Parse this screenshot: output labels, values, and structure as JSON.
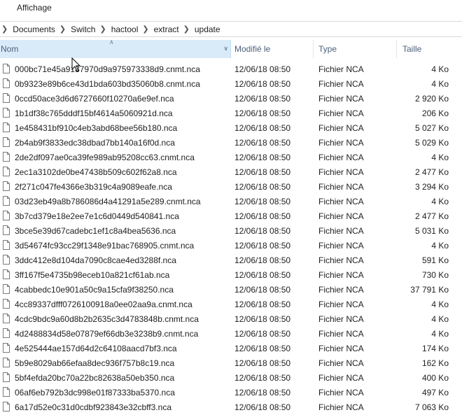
{
  "ribbon": {
    "tab": "Affichage"
  },
  "address": {
    "segments": [
      "Documents",
      "Switch",
      "hactool",
      "extract",
      "update"
    ]
  },
  "columns": {
    "name": "Nom",
    "modified": "Modifié le",
    "type": "Type",
    "size": "Taille"
  },
  "files": [
    {
      "name": "000bc71e45a9187970d9a975973338d9.cnmt.nca",
      "modified": "12/06/18 08:50",
      "type": "Fichier NCA",
      "size": "4 Ko"
    },
    {
      "name": "0b9323e89b6ce43d1bda603bd35060b8.cnmt.nca",
      "modified": "12/06/18 08:50",
      "type": "Fichier NCA",
      "size": "4 Ko"
    },
    {
      "name": "0ccd50ace3d6d6727660f10270a6e9ef.nca",
      "modified": "12/06/18 08:50",
      "type": "Fichier NCA",
      "size": "2 920 Ko"
    },
    {
      "name": "1b1df38c765dddf15bf4614a5060921d.nca",
      "modified": "12/06/18 08:50",
      "type": "Fichier NCA",
      "size": "206 Ko"
    },
    {
      "name": "1e458431bf910c4eb3abd68bee56b180.nca",
      "modified": "12/06/18 08:50",
      "type": "Fichier NCA",
      "size": "5 027 Ko"
    },
    {
      "name": "2b4ab9f3833edc38dbad7bb140a16f0d.nca",
      "modified": "12/06/18 08:50",
      "type": "Fichier NCA",
      "size": "5 029 Ko"
    },
    {
      "name": "2de2df097ae0ca39fe989ab95208cc63.cnmt.nca",
      "modified": "12/06/18 08:50",
      "type": "Fichier NCA",
      "size": "4 Ko"
    },
    {
      "name": "2ec1a3102de0be47438b509c602f62a8.nca",
      "modified": "12/06/18 08:50",
      "type": "Fichier NCA",
      "size": "2 477 Ko"
    },
    {
      "name": "2f271c047fe4366e3b319c4a9089eafe.nca",
      "modified": "12/06/18 08:50",
      "type": "Fichier NCA",
      "size": "3 294 Ko"
    },
    {
      "name": "03d23eb49a8b786086d4a41291a5e289.cnmt.nca",
      "modified": "12/06/18 08:50",
      "type": "Fichier NCA",
      "size": "4 Ko"
    },
    {
      "name": "3b7cd379e18e2ee7e1c6d0449d540841.nca",
      "modified": "12/06/18 08:50",
      "type": "Fichier NCA",
      "size": "2 477 Ko"
    },
    {
      "name": "3bce5e39d67cadebc1ef1c8a4bea5636.nca",
      "modified": "12/06/18 08:50",
      "type": "Fichier NCA",
      "size": "5 031 Ko"
    },
    {
      "name": "3d54674fc93cc29f1348e91bac768905.cnmt.nca",
      "modified": "12/06/18 08:50",
      "type": "Fichier NCA",
      "size": "4 Ko"
    },
    {
      "name": "3ddc412e8d104da7090c8cae4ed3288f.nca",
      "modified": "12/06/18 08:50",
      "type": "Fichier NCA",
      "size": "591 Ko"
    },
    {
      "name": "3ff167f5e4735b98eceb10a821cf61ab.nca",
      "modified": "12/06/18 08:50",
      "type": "Fichier NCA",
      "size": "730 Ko"
    },
    {
      "name": "4cabbedc10e901a50c9a15cfa9f38250.nca",
      "modified": "12/06/18 08:50",
      "type": "Fichier NCA",
      "size": "37 791 Ko"
    },
    {
      "name": "4cc89337dfff0726100918a0ee02aa9a.cnmt.nca",
      "modified": "12/06/18 08:50",
      "type": "Fichier NCA",
      "size": "4 Ko"
    },
    {
      "name": "4cdc9bdc9a60d8b2b2635c3d4783848b.cnmt.nca",
      "modified": "12/06/18 08:50",
      "type": "Fichier NCA",
      "size": "4 Ko"
    },
    {
      "name": "4d2488834d58e07879ef66db3e3238b9.cnmt.nca",
      "modified": "12/06/18 08:50",
      "type": "Fichier NCA",
      "size": "4 Ko"
    },
    {
      "name": "4e525444ae157d64d2c64108aacd7bf3.nca",
      "modified": "12/06/18 08:50",
      "type": "Fichier NCA",
      "size": "174 Ko"
    },
    {
      "name": "5b9e8029ab66efaa8dec936f757b8c19.nca",
      "modified": "12/06/18 08:50",
      "type": "Fichier NCA",
      "size": "162 Ko"
    },
    {
      "name": "5bf4efda20bc70a22bc82638a50eb350.nca",
      "modified": "12/06/18 08:50",
      "type": "Fichier NCA",
      "size": "400 Ko"
    },
    {
      "name": "06af6eb792b3dc998e01f87333ba5370.nca",
      "modified": "12/06/18 08:50",
      "type": "Fichier NCA",
      "size": "497 Ko"
    },
    {
      "name": "6a17d52e0c31d0cdbf923843e32cbff3.nca",
      "modified": "12/06/18 08:50",
      "type": "Fichier NCA",
      "size": "7 063 Ko"
    }
  ],
  "colors": {
    "header_selected": "#d9ebf9",
    "header_text": "#4c607a"
  },
  "icons": {
    "file": "document-icon",
    "separator": "chevron-right-icon",
    "sort": "sort-up-icon",
    "column_menu": "chevron-down-icon",
    "cursor": "mouse-cursor-icon"
  }
}
